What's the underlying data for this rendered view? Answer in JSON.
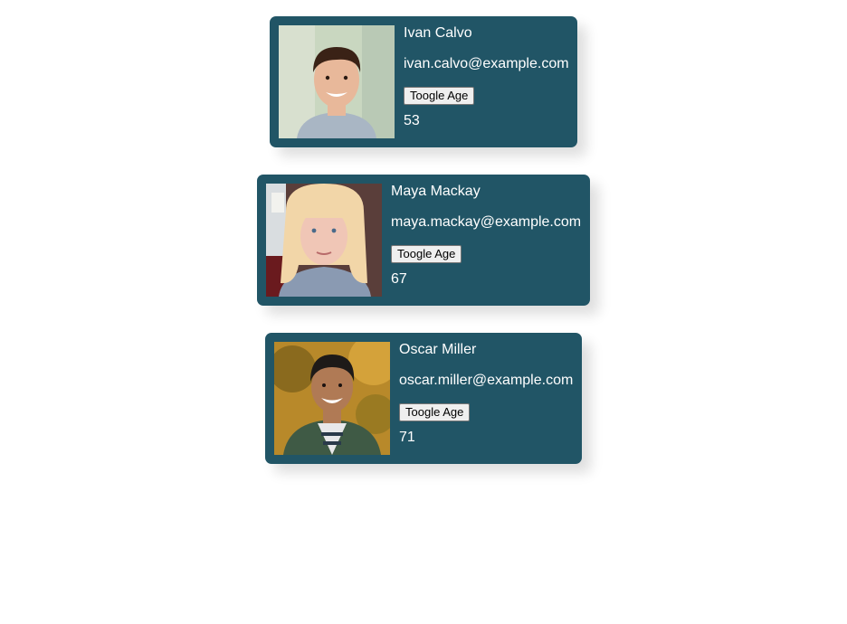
{
  "button_label": "Toogle Age",
  "people": [
    {
      "name": "Ivan Calvo",
      "email": "ivan.calvo@example.com",
      "age": "53",
      "photo_icon": "man-short-hair-portrait",
      "bg": "#c9d7c0",
      "skin": "#e8b89a",
      "hair": "#3a2216",
      "shirt": "#a9b6c4"
    },
    {
      "name": "Maya Mackay",
      "email": "maya.mackay@example.com",
      "age": "67",
      "photo_icon": "woman-blonde-portrait",
      "bg": "#5a3e3a",
      "skin": "#f0c6b6",
      "hair": "#f2d6a8",
      "shirt": "#8a9ab2"
    },
    {
      "name": "Oscar Miller",
      "email": "oscar.miller@example.com",
      "age": "71",
      "photo_icon": "man-smiling-outdoor-portrait",
      "bg": "#b8892a",
      "skin": "#b07a55",
      "hair": "#1e1a18",
      "shirt": "#3f5a45"
    }
  ]
}
